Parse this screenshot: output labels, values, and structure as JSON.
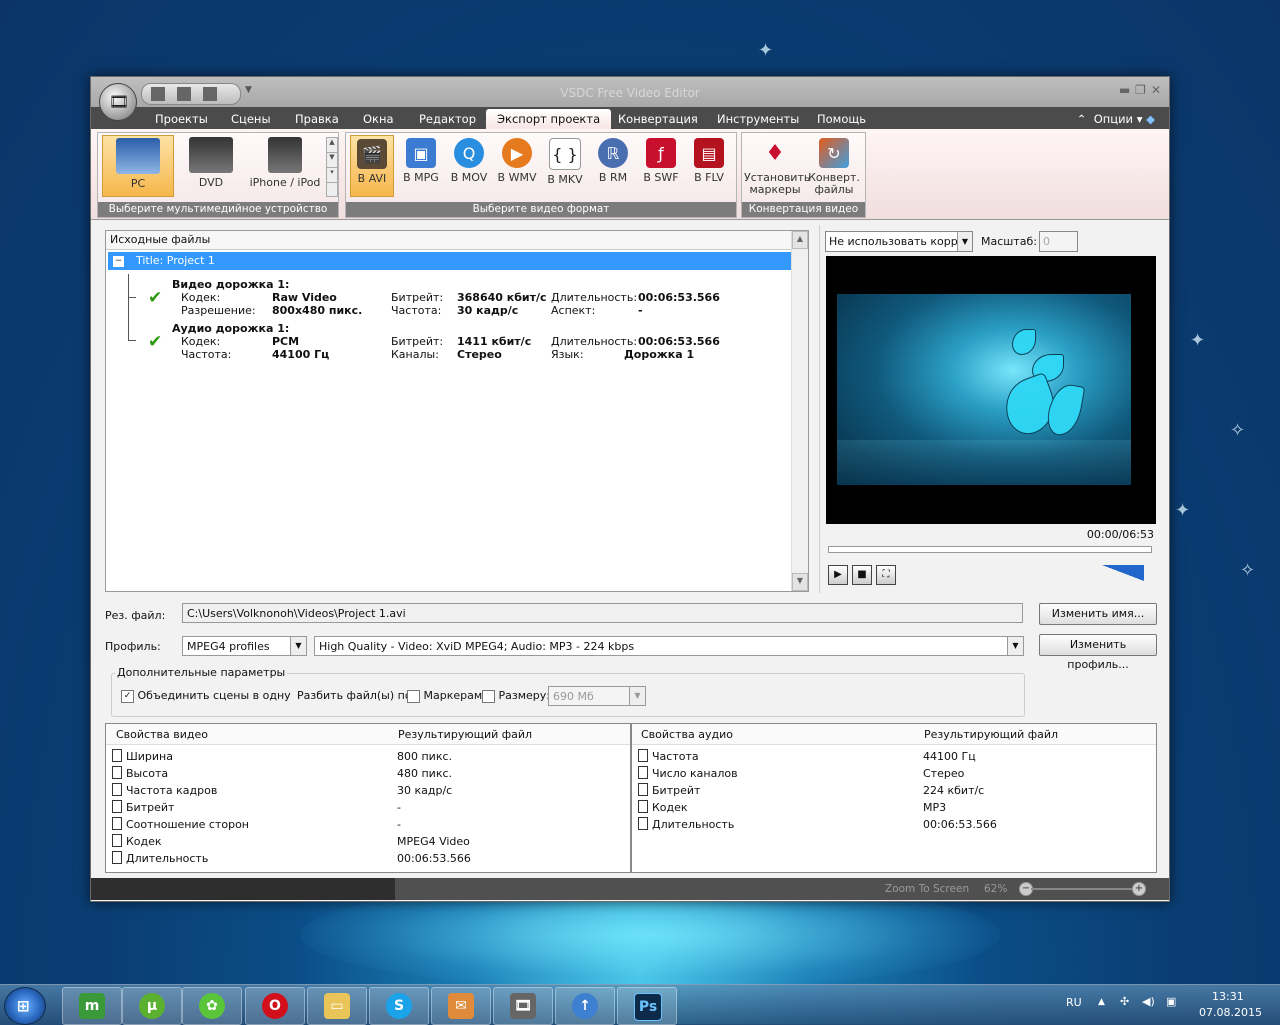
{
  "window": {
    "title": "VSDC Free Video Editor"
  },
  "menu": {
    "tabs": [
      "Проекты",
      "Сцены",
      "Правка",
      "Окна",
      "Редактор",
      "Экспорт проекта",
      "Конвертация",
      "Инструменты",
      "Помощь"
    ],
    "options_label": "Опции"
  },
  "ribbon": {
    "devices": [
      "PC",
      "DVD",
      "iPhone / iPod"
    ],
    "devices_group": "Выберите мультимедийное устройство",
    "formats": [
      "В AVI",
      "В MPG",
      "В MOV",
      "В WMV",
      "В MKV",
      "В RM",
      "В SWF",
      "В FLV"
    ],
    "formats_group": "Выберите видео формат",
    "convert_markers_line1": "Установить",
    "convert_markers_line2": "маркеры",
    "convert_files_line1": "Конверт.",
    "convert_files_line2": "файлы",
    "convert_group": "Конвертация видео"
  },
  "source": {
    "header": "Исходные файлы",
    "title_row": "Title: Project 1",
    "video_track": "Видео дорожка 1:",
    "audio_track": "Аудио дорожка 1:",
    "codec_label": "Кодек:",
    "resolution_label": "Разрешение:",
    "bitrate_label": "Битрейт:",
    "rate_label": "Частота:",
    "duration_label": "Длительность:",
    "aspect_label": "Аспект:",
    "channels_label": "Каналы:",
    "language_label": "Язык:",
    "v_codec": "Raw Video",
    "v_resolution": "800x480 пикс.",
    "v_bitrate": "368640 кбит/с",
    "v_rate": "30 кадр/с",
    "v_duration": "00:06:53.566",
    "v_aspect": "-",
    "a_codec": "PCM",
    "a_rate": "44100 Гц",
    "a_bitrate": "1411 кбит/с",
    "a_channels": "Стерео",
    "a_duration": "00:06:53.566",
    "a_language": "Дорожка 1"
  },
  "preview": {
    "aspect_select": "Не использовать коррек",
    "scale_label": "Масштаб:",
    "scale_value": "0",
    "time": "00:00/06:53",
    "progress": 0
  },
  "output": {
    "file_label": "Рез. файл:",
    "file_path": "C:\\Users\\Volknonoh\\Videos\\Project 1.avi",
    "rename_button": "Изменить имя...",
    "profile_label": "Профиль:",
    "profile_value": "MPEG4 profiles",
    "profile_desc": "High Quality - Video: XviD MPEG4; Audio: MP3 - 224 kbps",
    "change_profile_button": "Изменить профиль..."
  },
  "extra": {
    "legend": "Дополнительные параметры",
    "merge_label": "Объединить сцены в одну",
    "merge_checked": true,
    "split_label": "Разбить файл(ы) по:",
    "markers_label": "Маркерам",
    "size_label": "Размеру:",
    "size_value": "690 Мб"
  },
  "video_props": {
    "col1": "Свойства видео",
    "col2": "Результирующий файл",
    "rows": [
      {
        "name": "Ширина",
        "value": "800 пикс."
      },
      {
        "name": "Высота",
        "value": "480 пикс."
      },
      {
        "name": "Частота кадров",
        "value": "30 кадр/с"
      },
      {
        "name": "Битрейт",
        "value": "-"
      },
      {
        "name": "Соотношение сторон",
        "value": "-"
      },
      {
        "name": "Кодек",
        "value": "MPEG4 Video"
      },
      {
        "name": "Длительность",
        "value": "00:06:53.566"
      }
    ]
  },
  "audio_props": {
    "col1": "Свойства аудио",
    "col2": "Результирующий файл",
    "rows": [
      {
        "name": "Частота",
        "value": "44100 Гц"
      },
      {
        "name": "Число каналов",
        "value": "Стерео"
      },
      {
        "name": "Битрейт",
        "value": "224 кбит/с"
      },
      {
        "name": "Кодек",
        "value": "MP3"
      },
      {
        "name": "Длительность",
        "value": "00:06:53.566"
      }
    ]
  },
  "status": {
    "zoom_label": "Zoom To Screen",
    "zoom_value": "62%"
  },
  "taskbar": {
    "lang": "RU",
    "time": "13:31",
    "date": "07.08.2015",
    "apps": [
      "mediaget-icon",
      "utorrent-icon",
      "icq-icon",
      "opera-icon",
      "explorer-icon",
      "skype-icon",
      "messenger-icon",
      "video-editor-icon",
      "uploader-icon",
      "photoshop-icon"
    ]
  }
}
